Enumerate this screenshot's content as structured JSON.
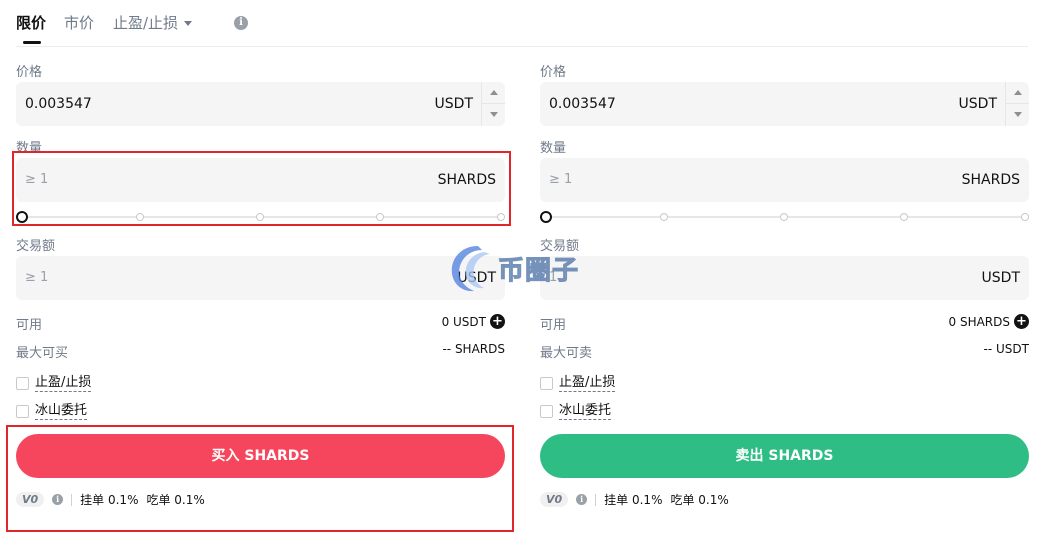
{
  "tabs": {
    "limit": "限价",
    "market": "市价",
    "stop": "止盈/止损"
  },
  "buy": {
    "price_label": "价格",
    "price_value": "0.003547",
    "price_unit": "USDT",
    "qty_label": "数量",
    "qty_placeholder": "≥ 1",
    "qty_unit": "SHARDS",
    "amount_label": "交易额",
    "amount_placeholder": "≥ 1",
    "amount_unit": "USDT",
    "avail_label": "可用",
    "avail_value": "0 USDT",
    "max_label": "最大可买",
    "max_value": "-- SHARDS",
    "tpsl": "止盈/止损",
    "iceberg": "冰山委托",
    "button": "买入 SHARDS",
    "vip": "V0",
    "maker": "挂单 0.1%",
    "taker": "吃单 0.1%",
    "slider_value": 0
  },
  "sell": {
    "price_label": "价格",
    "price_value": "0.003547",
    "price_unit": "USDT",
    "qty_label": "数量",
    "qty_placeholder": "≥ 1",
    "qty_unit": "SHARDS",
    "amount_label": "交易额",
    "amount_placeholder": "1",
    "amount_unit": "USDT",
    "avail_label": "可用",
    "avail_value": "0 SHARDS",
    "max_label": "最大可卖",
    "max_value": "-- USDT",
    "tpsl": "止盈/止损",
    "iceberg": "冰山委托",
    "button": "卖出 SHARDS",
    "vip": "V0",
    "maker": "挂单 0.1%",
    "taker": "吃单 0.1%",
    "slider_value": 0
  },
  "watermark": "币圈子",
  "colors": {
    "buy": "#f6465d",
    "sell": "#2ebd85",
    "highlight": "#e0262b"
  },
  "icons": [
    "info-icon",
    "chevron-down-icon",
    "plus-circle-icon",
    "stepper-up-icon",
    "stepper-down-icon"
  ]
}
